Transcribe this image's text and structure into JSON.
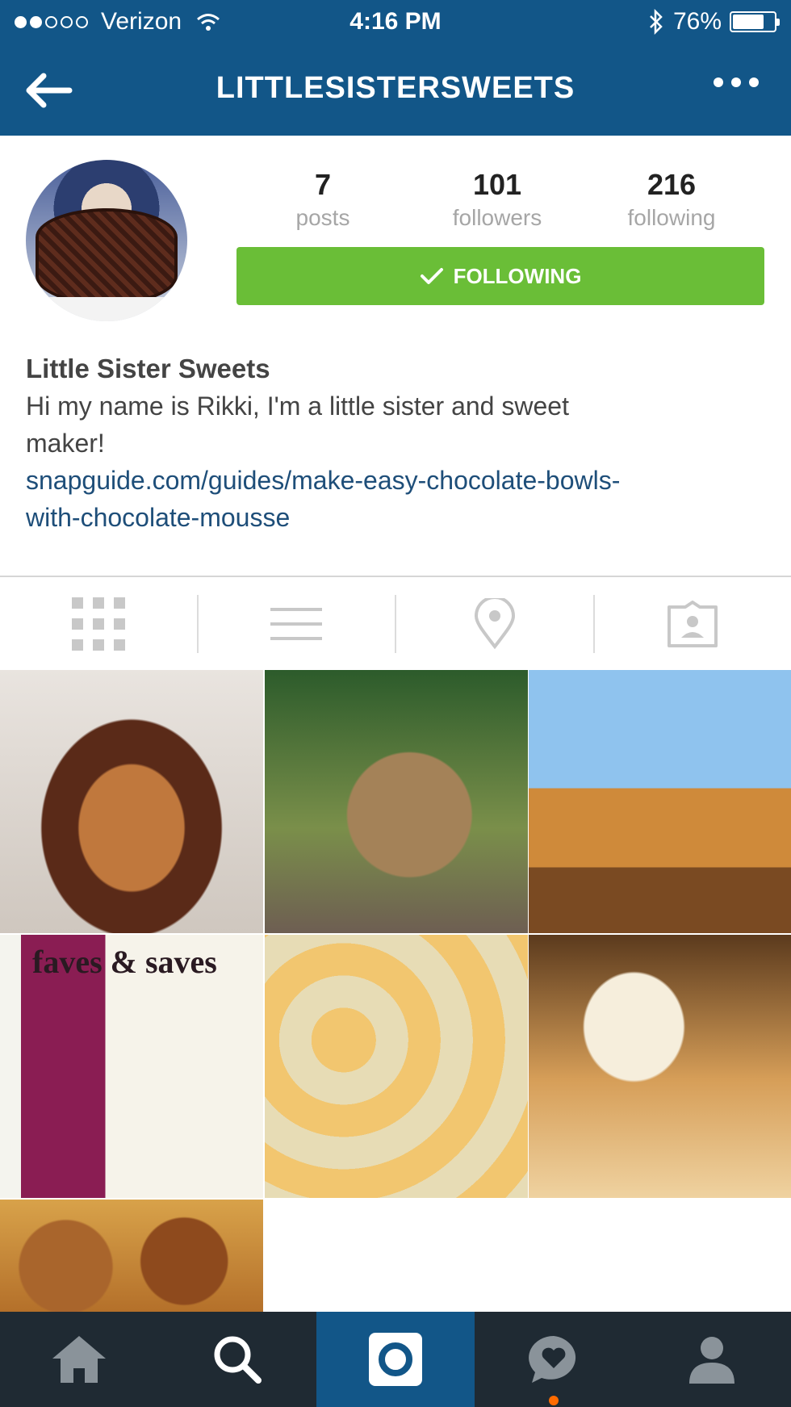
{
  "status_bar": {
    "carrier": "Verizon",
    "time": "4:16 PM",
    "battery": "76%",
    "battery_level": 0.76
  },
  "nav": {
    "title": "LITTLESISTERSWEETS"
  },
  "profile": {
    "stats": [
      {
        "value": "7",
        "label": "posts"
      },
      {
        "value": "101",
        "label": "followers"
      },
      {
        "value": "216",
        "label": "following"
      }
    ],
    "follow_button_label": "FOLLOWING",
    "display_name": "Little Sister Sweets",
    "bio_line1": "Hi my name is Rikki, I'm a little sister and sweet",
    "bio_line2": "maker!",
    "link_line1": "snapguide.com/guides/make-easy-chocolate-bowls-",
    "link_line2": "with-chocolate-mousse"
  },
  "photo_text": {
    "faves_saves": "faves & saves"
  },
  "colors": {
    "header": "#125688",
    "follow_green": "#6abe37",
    "link": "#1e4e79",
    "tabbar": "#1f2a33"
  }
}
